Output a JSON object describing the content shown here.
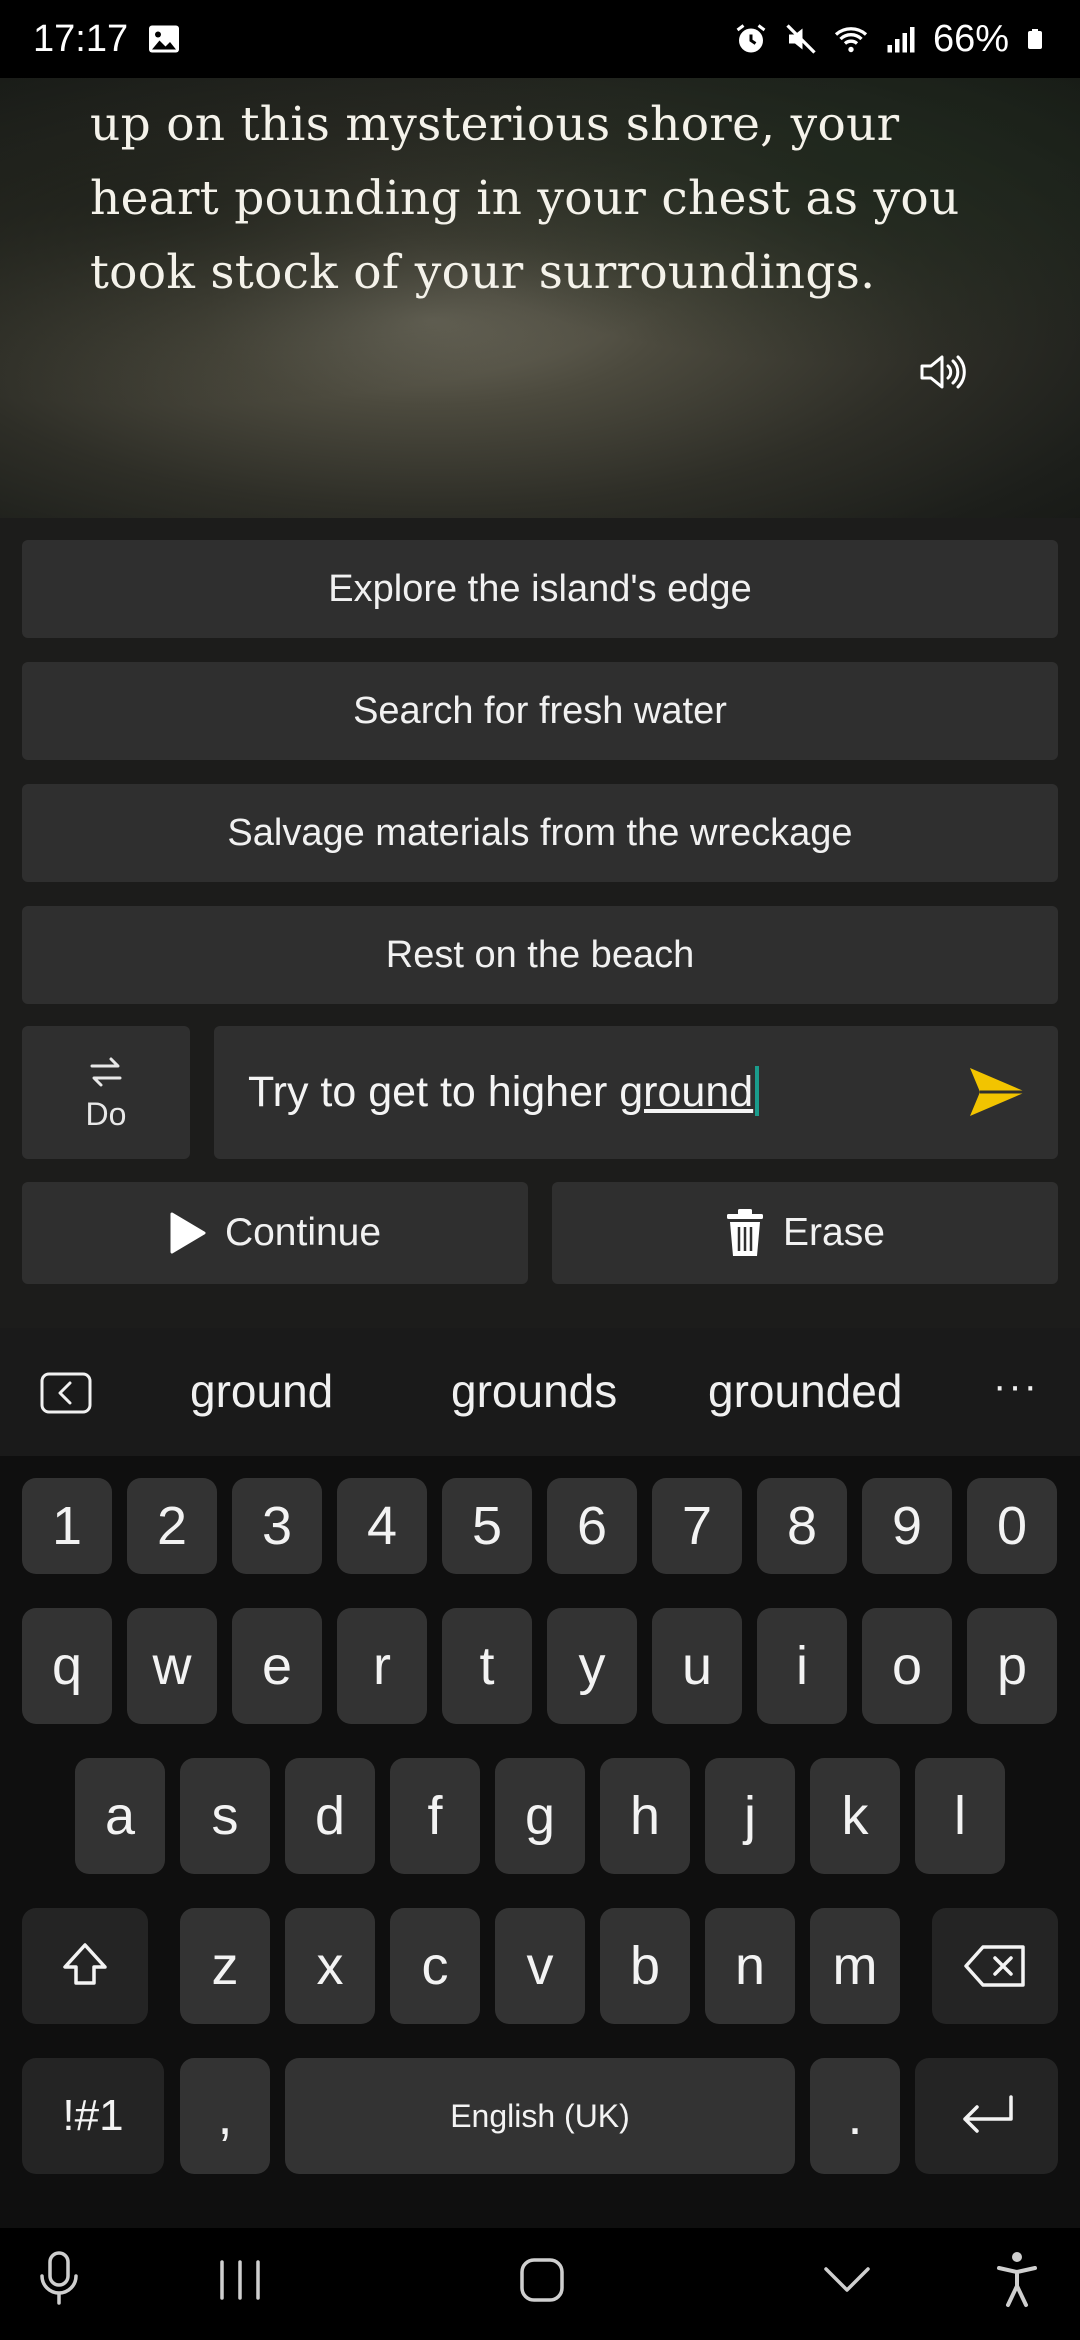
{
  "status_bar": {
    "time": "17:17",
    "battery": "66%",
    "icons": [
      "image-icon",
      "alarm-icon",
      "mute-icon",
      "wifi-icon",
      "signal-icon",
      "battery-icon"
    ]
  },
  "story": {
    "lines": [
      "up on this mysterious shore, your",
      "heart pounding in your chest as you",
      "took stock of your surroundings."
    ]
  },
  "choices": [
    "Explore the island's edge",
    "Search for fresh water",
    "Salvage materials from the wreckage",
    "Rest on the beach"
  ],
  "mode": {
    "label": "Do"
  },
  "input": {
    "text_before": "Try to get to higher ",
    "text_underlined": "ground"
  },
  "actions": {
    "continue_label": "Continue",
    "erase_label": "Erase"
  },
  "keyboard": {
    "suggestions": [
      "ground",
      "grounds",
      "grounded"
    ],
    "more": "···",
    "row_numbers": [
      "1",
      "2",
      "3",
      "4",
      "5",
      "6",
      "7",
      "8",
      "9",
      "0"
    ],
    "row1": [
      "q",
      "w",
      "e",
      "r",
      "t",
      "y",
      "u",
      "i",
      "o",
      "p"
    ],
    "row2": [
      "a",
      "s",
      "d",
      "f",
      "g",
      "h",
      "j",
      "k",
      "l"
    ],
    "row3": [
      "z",
      "x",
      "c",
      "v",
      "b",
      "n",
      "m"
    ],
    "symbols_label": "!#1",
    "comma": ",",
    "space_label": "English (UK)",
    "period": "."
  },
  "colors": {
    "accent_send": "#f2c400",
    "caret": "#1a9c8c",
    "button_bg": "#2f2f2f"
  }
}
